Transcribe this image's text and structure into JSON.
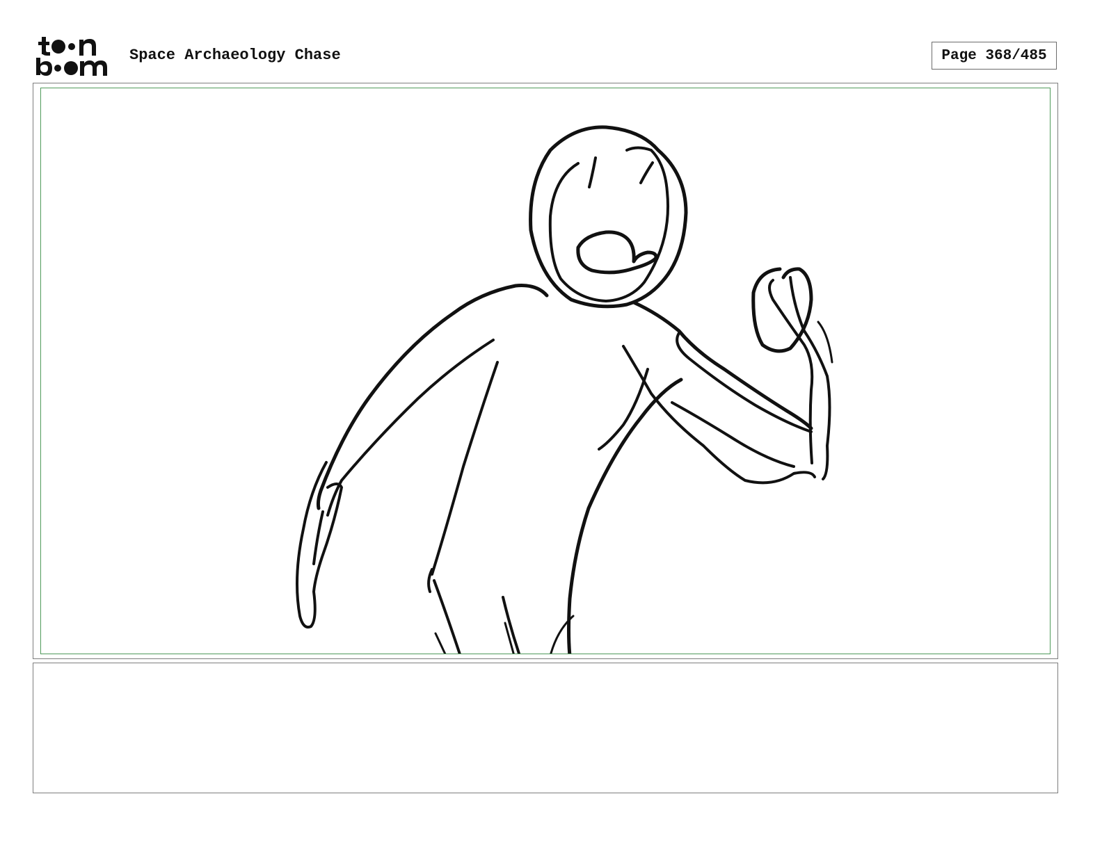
{
  "header": {
    "logo_text": "toonboom",
    "project_title": "Space Archaeology Chase",
    "page_label": "Page 368/485"
  },
  "panel": {
    "caption": ""
  },
  "colors": {
    "ink": "#111111",
    "panel_border": "#7d7d7d",
    "safe_frame": "#4f9a5a"
  }
}
